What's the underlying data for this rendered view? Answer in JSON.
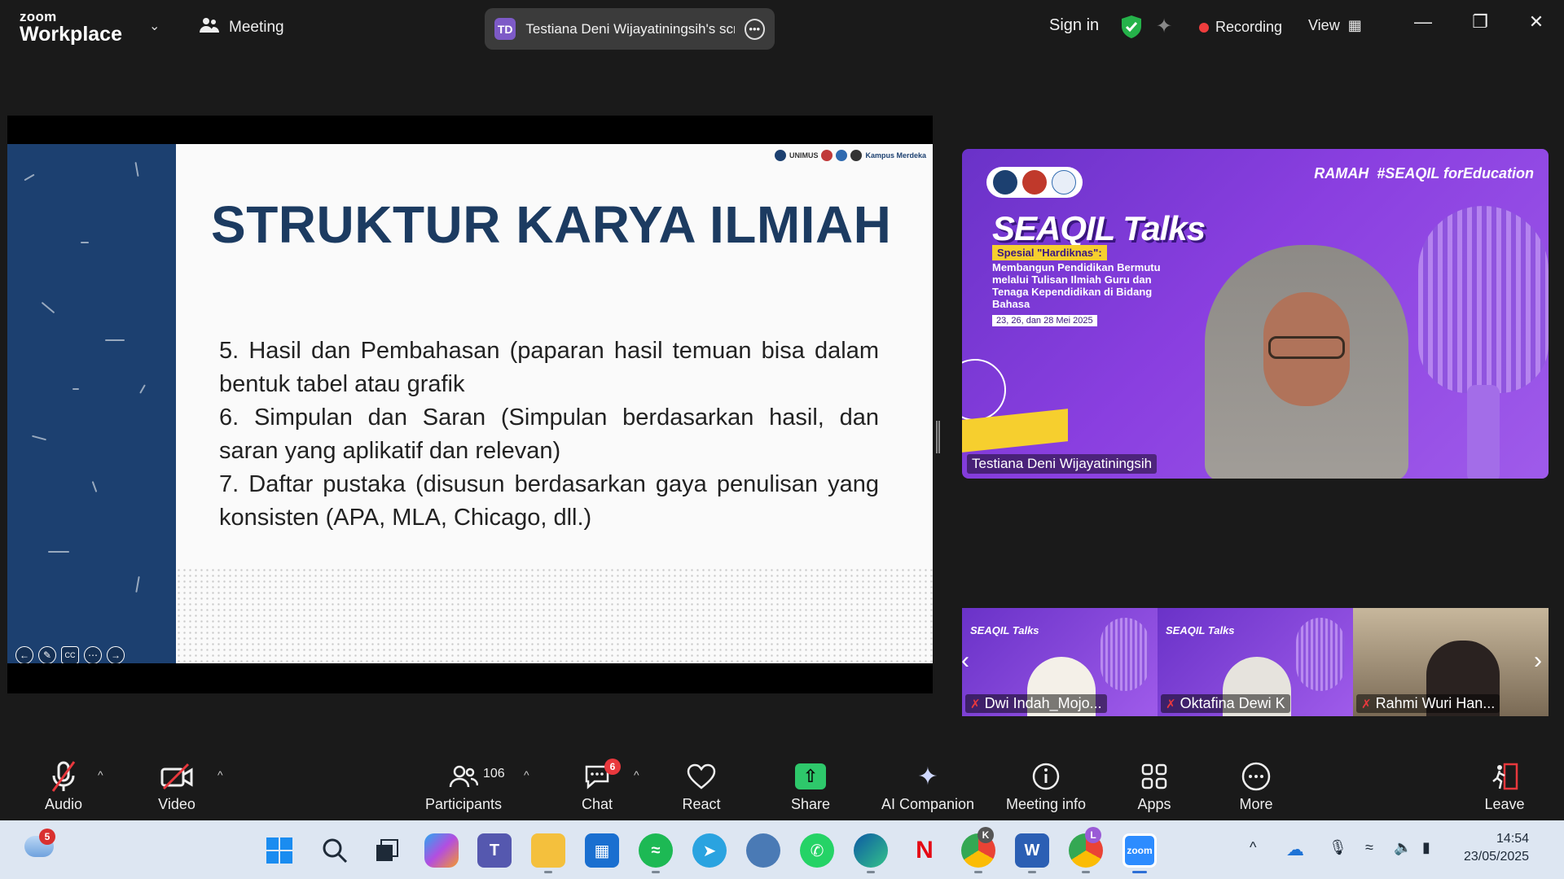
{
  "app": {
    "logo_top": "zoom",
    "logo_bottom": "Workplace",
    "meeting_label": "Meeting",
    "share_title": "Testiana Deni Wijayatiningsih's scr",
    "share_initials": "TD",
    "sign_in": "Sign in",
    "recording": "Recording",
    "view": "View"
  },
  "slide": {
    "title": "STRUKTUR KARYA ILMIAH",
    "logos_text": "UNIMUS",
    "logos_text2": "Kampus Merdeka",
    "points": [
      "5. Hasil dan Pembahasan (paparan hasil temuan bisa dalam bentuk tabel atau grafik",
      "6. Simpulan dan Saran (Simpulan berdasarkan hasil, dan saran yang aplikatif dan relevan)",
      "7. Daftar pustaka (disusun berdasarkan gaya penulisan yang konsisten (APA, MLA, Chicago, dll.)"
    ]
  },
  "main_video": {
    "name": "Testiana Deni Wijayatiningsih",
    "banner_title": "SEAQIL Talks",
    "tag": "Spesial \"Hardiknas\":",
    "subtitle": "Membangun Pendidikan Bermutu melalui Tulisan Ilmiah Guru dan Tenaga Kependidikan di Bidang Bahasa",
    "date": "23, 26, dan 28 Mei 2025",
    "brand1": "RAMAH",
    "brand2": "#SEAQIL forEducation"
  },
  "thumbs": [
    {
      "name": "Dwi Indah_Mojo...",
      "title": "SEAQIL Talks"
    },
    {
      "name": "Oktafina Dewi K",
      "title": "SEAQIL Talks"
    },
    {
      "name": "Rahmi Wuri Han..."
    }
  ],
  "toolbar": {
    "audio": "Audio",
    "video": "Video",
    "participants": "Participants",
    "participants_count": "106",
    "chat": "Chat",
    "chat_badge": "6",
    "react": "React",
    "share": "Share",
    "ai": "AI Companion",
    "info": "Meeting info",
    "apps": "Apps",
    "more": "More",
    "leave": "Leave"
  },
  "taskbar": {
    "weather_badge": "5",
    "chrome_badge_1": "K",
    "chrome_badge_2": "L",
    "zoom_label": "zoom",
    "time": "14:54",
    "date": "23/05/2025"
  }
}
